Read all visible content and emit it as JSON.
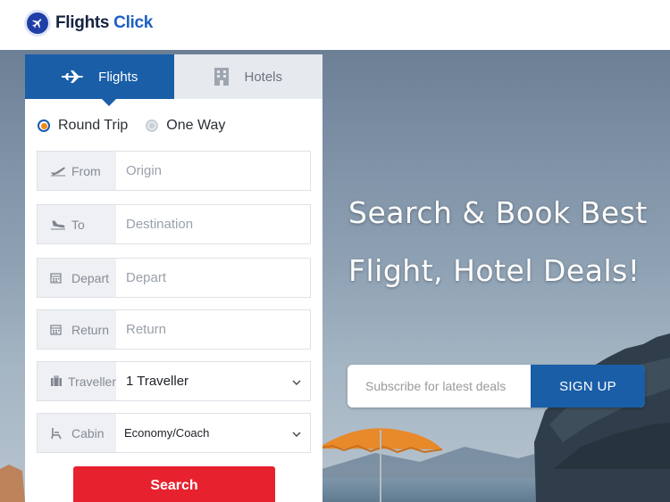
{
  "brand": {
    "name_part1": "Flights",
    "name_part2": "Click"
  },
  "hero": {
    "headline_line1": "Search & Book Best",
    "headline_line2": "Flight, Hotel Deals!",
    "subscribe_placeholder": "Subscribe for latest deals",
    "subscribe_button": "SIGN UP"
  },
  "tabs": [
    {
      "label": "Flights",
      "icon": "airplane-icon",
      "active": true
    },
    {
      "label": "Hotels",
      "icon": "building-icon",
      "active": false
    }
  ],
  "trip_type": {
    "round_trip": "Round Trip",
    "one_way": "One Way",
    "selected": "Round Trip"
  },
  "fields": {
    "from": {
      "label": "From",
      "placeholder": "Origin"
    },
    "to": {
      "label": "To",
      "placeholder": "Destination"
    },
    "depart": {
      "label": "Depart",
      "placeholder": "Depart"
    },
    "return": {
      "label": "Return",
      "placeholder": "Return"
    },
    "traveller": {
      "label": "Traveller",
      "value": "1 Traveller"
    },
    "cabin": {
      "label": "Cabin",
      "value": "Economy/Coach"
    }
  },
  "search_button": "Search",
  "colors": {
    "primary_blue": "#1a5ea8",
    "accent_red": "#e8212f",
    "radio_orange": "#f08a1c",
    "brand_navy": "#1f3fa8"
  }
}
